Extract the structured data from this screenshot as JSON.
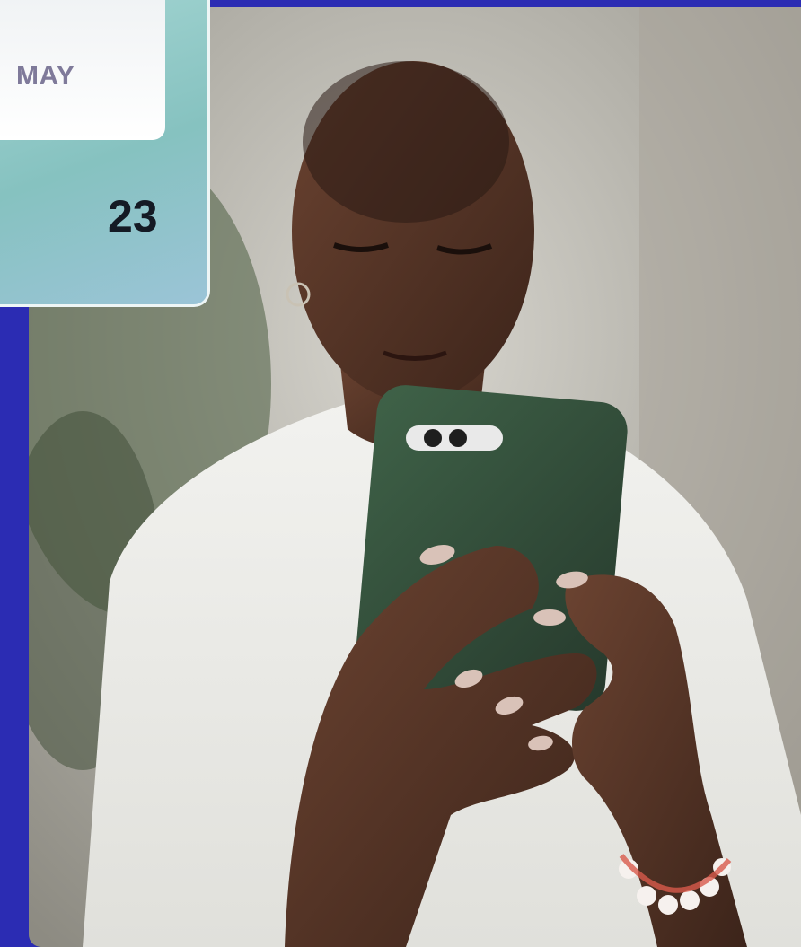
{
  "calendar_card": {
    "month": "MAY",
    "day": "23"
  },
  "photo": {
    "subject": "person-holding-smartphone"
  },
  "colors": {
    "background": "#2b2cb3",
    "card_gradient_start": "#a7d7d4",
    "card_gradient_end": "#9bc4d7",
    "month_text": "#7f7a9a",
    "day_text": "#141a24",
    "accent_arc": "#e8475f"
  }
}
